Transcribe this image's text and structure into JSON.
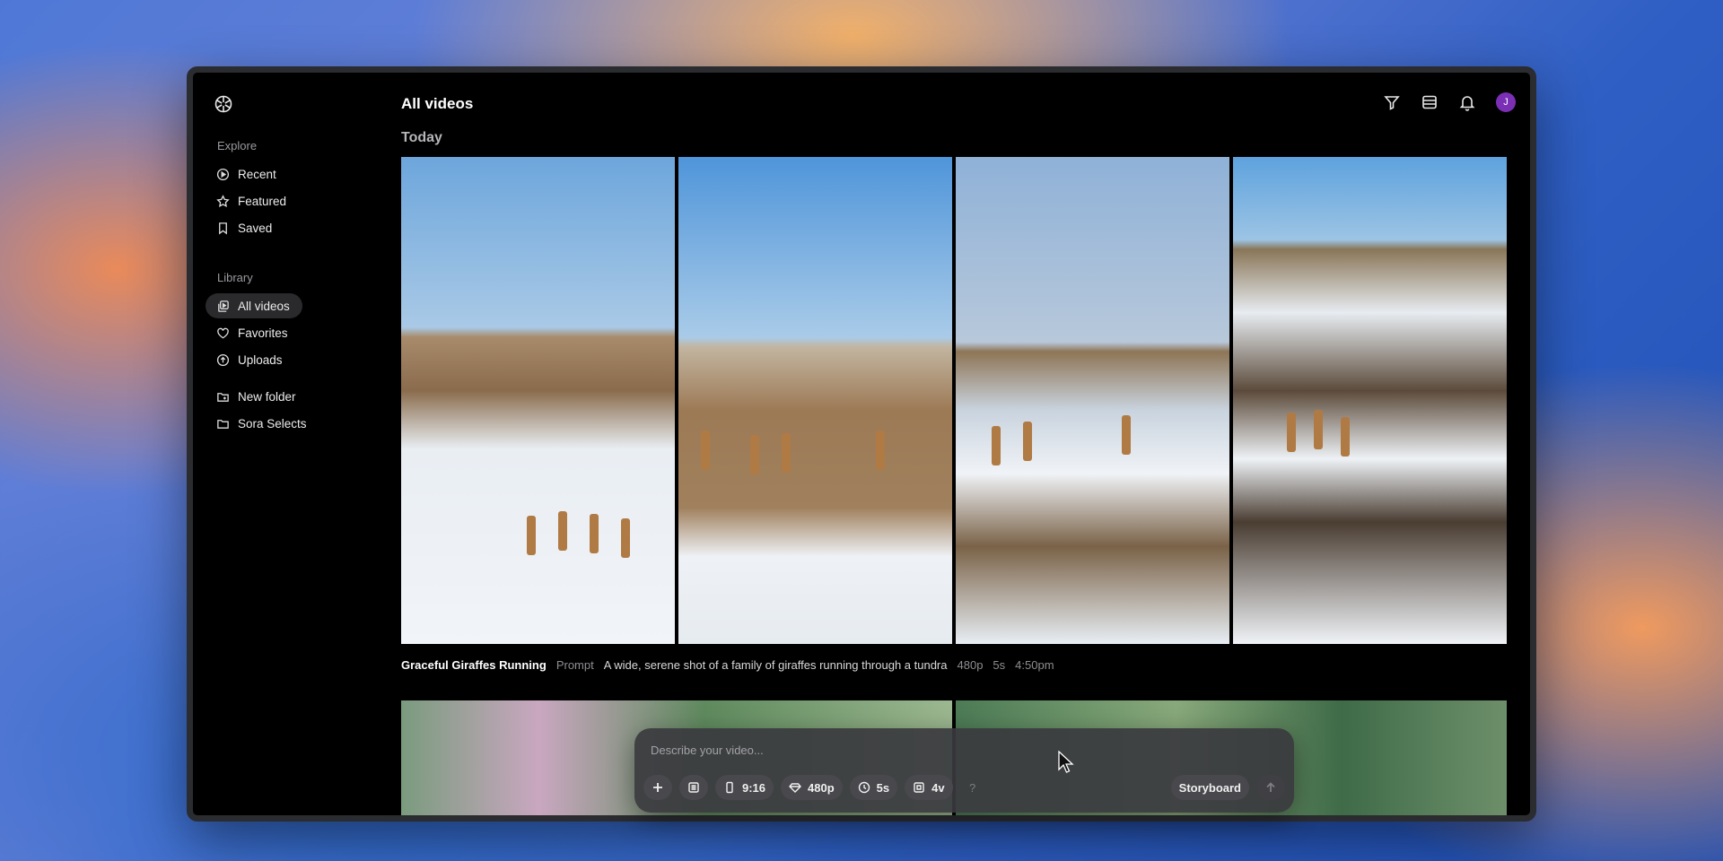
{
  "app": {
    "avatar_initial": "J"
  },
  "sidebar": {
    "explore_label": "Explore",
    "explore_items": [
      {
        "label": "Recent",
        "icon": "play-circle-icon"
      },
      {
        "label": "Featured",
        "icon": "star-icon"
      },
      {
        "label": "Saved",
        "icon": "bookmark-icon"
      }
    ],
    "library_label": "Library",
    "library_items": [
      {
        "label": "All videos",
        "icon": "library-icon",
        "active": true
      },
      {
        "label": "Favorites",
        "icon": "heart-icon"
      },
      {
        "label": "Uploads",
        "icon": "upload-circle-icon"
      }
    ],
    "folder_items": [
      {
        "label": "New folder",
        "icon": "folder-plus-icon"
      },
      {
        "label": "Sora Selects",
        "icon": "folder-icon"
      }
    ]
  },
  "header": {
    "title": "All videos",
    "icons": [
      "filter-icon",
      "grid-view-icon",
      "bell-icon"
    ]
  },
  "feed": {
    "group_label": "Today",
    "item": {
      "title": "Graceful Giraffes Running",
      "prompt_label": "Prompt",
      "prompt": "A wide, serene shot of a family of giraffes running through a tundra",
      "resolution": "480p",
      "duration": "5s",
      "time": "4:50pm"
    }
  },
  "composer": {
    "placeholder": "Describe your video...",
    "aspect_ratio": "9:16",
    "resolution": "480p",
    "duration": "5s",
    "variations": "4v",
    "help": "?",
    "storyboard_label": "Storyboard"
  },
  "colors": {
    "accent_avatar": "#7b2fb5",
    "window_bg": "#000000"
  }
}
